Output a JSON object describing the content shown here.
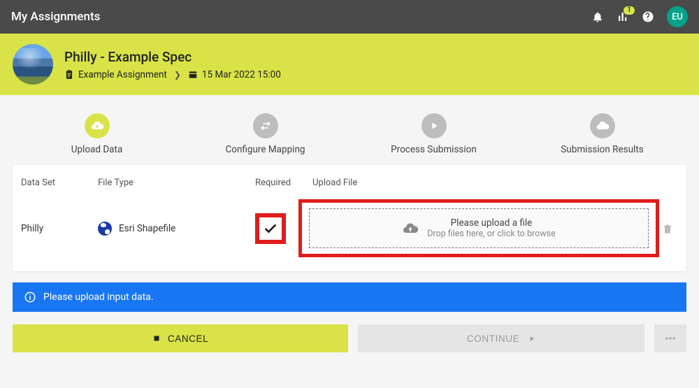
{
  "topbar": {
    "title": "My Assignments",
    "notification_icon": "bell-icon",
    "stats_icon": "chart-icon",
    "stats_badge": "1",
    "help_icon": "help-icon",
    "user_initials": "EU"
  },
  "spec": {
    "title": "Philly - Example Spec",
    "crumb_assignment_icon": "clipboard-icon",
    "crumb_assignment": "Example Assignment",
    "crumb_date_icon": "calendar-stats-icon",
    "crumb_date": "15 Mar 2022 15:00"
  },
  "stepper": {
    "steps": [
      {
        "label": "Upload Data",
        "icon": "cloud-upload-icon",
        "active": true
      },
      {
        "label": "Configure Mapping",
        "icon": "swap-icon",
        "active": false
      },
      {
        "label": "Process Submission",
        "icon": "play-icon",
        "active": false
      },
      {
        "label": "Submission Results",
        "icon": "cloud-icon",
        "active": false
      }
    ]
  },
  "table": {
    "headers": {
      "dataset": "Data Set",
      "filetype": "File Type",
      "required": "Required",
      "upload": "Upload File"
    },
    "row": {
      "dataset": "Philly",
      "filetype": "Esri Shapefile",
      "required": true,
      "upload_title": "Please upload a file",
      "upload_sub": "Drop files here, or click to browse"
    }
  },
  "alert": {
    "icon": "info-icon",
    "text": "Please upload input data."
  },
  "buttons": {
    "cancel_label": "CANCEL",
    "continue_label": "CONTINUE",
    "more_label": "..."
  },
  "colors": {
    "accent_lime": "#d9e347",
    "topbar_bg": "#4a4a4a",
    "highlight_red": "#e11c1c",
    "alert_blue": "#1976f2",
    "avatar_teal": "#00a38a"
  }
}
